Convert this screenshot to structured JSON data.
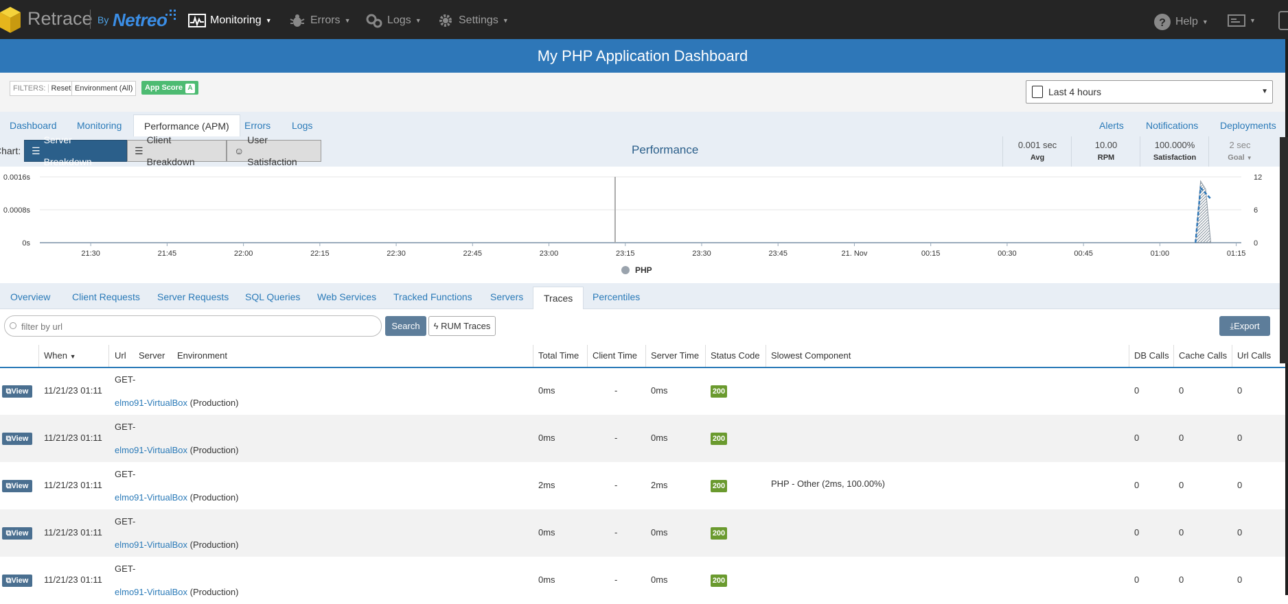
{
  "nav": {
    "brand": "Retrace",
    "by": "By",
    "netreo": "Netreo",
    "items": [
      {
        "label": "Monitoring",
        "icon": "monitoring-icon"
      },
      {
        "label": "Errors",
        "icon": "bug-icon"
      },
      {
        "label": "Logs",
        "icon": "gears-icon"
      },
      {
        "label": "Settings",
        "icon": "gear-icon"
      }
    ],
    "help": "Help"
  },
  "page_title": "My PHP Application Dashboard",
  "filters": {
    "label": "FILTERS:",
    "reset": "Reset",
    "environment": "Environment (All)",
    "app_score_label": "App Score",
    "app_score_grade": "A"
  },
  "time_range": "Last 4 hours",
  "tabs": [
    "Dashboard",
    "Monitoring",
    "Performance (APM)",
    "Errors",
    "Logs"
  ],
  "right_tabs": [
    "Alerts",
    "Notifications",
    "Deployments"
  ],
  "chart_toolbar": {
    "label": "Chart:",
    "buttons": [
      "Server Breakdown",
      "Client Breakdown",
      "User Satisfaction"
    ],
    "title": "Performance"
  },
  "stats": [
    {
      "value": "0.001 sec",
      "label": "Avg"
    },
    {
      "value": "10.00",
      "label": "RPM"
    },
    {
      "value": "100.000%",
      "label": "Satisfaction"
    },
    {
      "value": "2 sec",
      "label": "Goal"
    }
  ],
  "chart_data": {
    "type": "area",
    "x_ticks": [
      "21:30",
      "21:45",
      "22:00",
      "22:15",
      "22:30",
      "22:45",
      "23:00",
      "23:15",
      "23:30",
      "23:45",
      "21. Nov",
      "00:15",
      "00:30",
      "00:45",
      "01:00",
      "01:15"
    ],
    "y_left_ticks": [
      "0s",
      "0.0008s",
      "0.0016s"
    ],
    "y_right_ticks": [
      "0",
      "6",
      "12"
    ],
    "ylim": [
      0,
      0.0016
    ],
    "y2lim": [
      0,
      12
    ],
    "series": [
      {
        "name": "PHP",
        "x": [
          "01:07",
          "01:08",
          "01:09",
          "01:10"
        ],
        "values": [
          0,
          0.0015,
          0.0013,
          0
        ]
      },
      {
        "x": [
          "01:07",
          "01:08",
          "01:09",
          "01:10"
        ],
        "values": [
          0,
          10,
          9,
          8
        ]
      }
    ],
    "legend": "bottom-center"
  },
  "subtabs": [
    "Overview",
    "Client Requests",
    "Server Requests",
    "SQL Queries",
    "Web Services",
    "Tracked Functions",
    "Servers",
    "Traces",
    "Percentiles"
  ],
  "search": {
    "placeholder": "filter by url",
    "button": "Search",
    "rum": "RUM Traces",
    "export": "Export"
  },
  "table": {
    "columns": [
      "When",
      "Url",
      "Server",
      "Environment",
      "Total Time",
      "Client Time",
      "Server Time",
      "Status Code",
      "Slowest Component",
      "DB Calls",
      "Cache Calls",
      "Url Calls"
    ],
    "view_label": "View",
    "rows": [
      {
        "when": "11/21/23 01:11",
        "url": "GET-",
        "server": "elmo91-VirtualBox",
        "env": "(Production)",
        "total": "0ms",
        "client": "-",
        "server_time": "0ms",
        "status": "200",
        "slowest": "",
        "db": "0",
        "cache": "0",
        "urlcalls": "0"
      },
      {
        "when": "11/21/23 01:11",
        "url": "GET-",
        "server": "elmo91-VirtualBox",
        "env": "(Production)",
        "total": "0ms",
        "client": "-",
        "server_time": "0ms",
        "status": "200",
        "slowest": "",
        "db": "0",
        "cache": "0",
        "urlcalls": "0"
      },
      {
        "when": "11/21/23 01:11",
        "url": "GET-",
        "server": "elmo91-VirtualBox",
        "env": "(Production)",
        "total": "2ms",
        "client": "-",
        "server_time": "2ms",
        "status": "200",
        "slowest": "PHP - Other (2ms, 100.00%)",
        "db": "0",
        "cache": "0",
        "urlcalls": "0"
      },
      {
        "when": "11/21/23 01:11",
        "url": "GET-",
        "server": "elmo91-VirtualBox",
        "env": "(Production)",
        "total": "0ms",
        "client": "-",
        "server_time": "0ms",
        "status": "200",
        "slowest": "",
        "db": "0",
        "cache": "0",
        "urlcalls": "0"
      },
      {
        "when": "11/21/23 01:11",
        "url": "GET-",
        "server": "elmo91-VirtualBox",
        "env": "(Production)",
        "total": "0ms",
        "client": "-",
        "server_time": "0ms",
        "status": "200",
        "slowest": "",
        "db": "0",
        "cache": "0",
        "urlcalls": "0"
      }
    ]
  }
}
